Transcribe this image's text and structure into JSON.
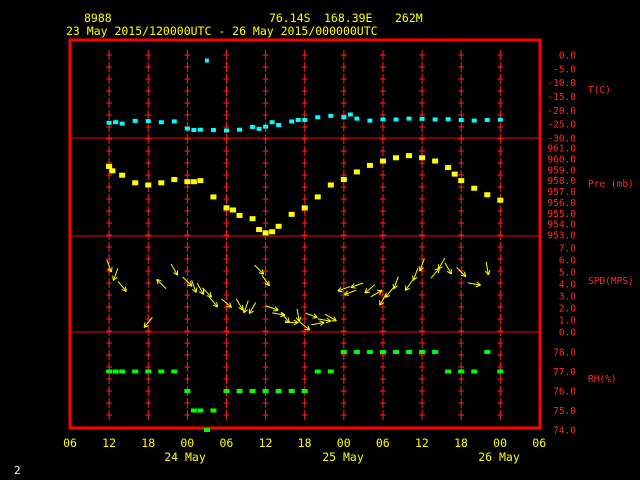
{
  "header": {
    "station": "8988",
    "lat": "76.14S",
    "lon": "168.39E",
    "elev": "262M",
    "period": "23 May 2015/120000UTC - 26 May 2015/000000UTC"
  },
  "corner_label": "2",
  "colors": {
    "frame": "#ff0000",
    "temp": "#00ffff",
    "pressure": "#ffff00",
    "wind": "#ffff00",
    "rh": "#00ff00",
    "labels": "#ffff00",
    "axis_text": "#ff2a2a"
  },
  "chart_data": [
    {
      "type": "scatter",
      "name": "T(C)",
      "ylabel": "T(C)",
      "ylim": [
        -30.0,
        0.0
      ],
      "yticks": [
        "0.0",
        "-5.0",
        "-10.0",
        "-15.0",
        "-20.0",
        "-25.0",
        "-30.0"
      ],
      "x_hours": [
        12,
        13,
        14,
        16,
        18,
        20,
        22,
        24,
        25,
        26,
        28,
        30,
        32,
        34,
        35,
        36,
        37,
        38,
        40,
        41,
        42,
        44,
        46,
        48,
        49,
        50,
        52,
        54,
        56,
        58,
        60,
        62,
        64,
        66,
        68,
        70,
        72
      ],
      "values": [
        -24.5,
        -24.3,
        -24.8,
        -23.8,
        -23.9,
        -24.3,
        -24.0,
        -26.6,
        -27.1,
        -27.0,
        -27.1,
        -27.3,
        -27.0,
        -26.0,
        -26.7,
        -25.9,
        -24.3,
        -25.3,
        -24.0,
        -23.5,
        -23.5,
        -22.5,
        -22.0,
        -22.5,
        -21.5,
        -23.0,
        -23.7,
        -23.3,
        -23.3,
        -23.0,
        -23.1,
        -23.3,
        -23.2,
        -23.5,
        -23.7,
        -23.5,
        -23.4
      ],
      "outliers": [
        {
          "x_hour": 27,
          "value": -2.0
        }
      ]
    },
    {
      "type": "scatter",
      "name": "Pre (mb)",
      "ylabel": "Pre (mb)",
      "ylim": [
        953.0,
        961.0
      ],
      "yticks": [
        "961.0",
        "960.0",
        "959.0",
        "958.0",
        "957.0",
        "956.0",
        "955.0",
        "954.0",
        "953.0"
      ],
      "x_hours": [
        12,
        12.5,
        14,
        16,
        18,
        20,
        22,
        24,
        25,
        26,
        28,
        30,
        31,
        32,
        34,
        35,
        36,
        37,
        38,
        40,
        42,
        44,
        46,
        48,
        50,
        52,
        54,
        56,
        58,
        60,
        62,
        64,
        65,
        66,
        68,
        70,
        72
      ],
      "values": [
        959.3,
        958.9,
        958.5,
        957.8,
        957.6,
        957.8,
        958.1,
        957.9,
        957.9,
        958.0,
        956.5,
        955.5,
        955.3,
        954.8,
        954.5,
        953.5,
        953.2,
        953.3,
        953.8,
        954.9,
        955.5,
        956.5,
        957.6,
        958.1,
        958.8,
        959.4,
        959.8,
        960.1,
        960.3,
        960.1,
        959.8,
        959.2,
        958.6,
        958.0,
        957.3,
        956.7,
        956.2
      ]
    },
    {
      "type": "scatter",
      "name": "SPD(MPS)",
      "ylabel": "SPD(MPS)",
      "ylim": [
        0.0,
        7.0
      ],
      "yticks": [
        "7.0",
        "6.0",
        "5.0",
        "4.0",
        "3.0",
        "2.0",
        "1.0",
        "0.0"
      ],
      "x_hours": [
        12,
        13,
        14,
        18,
        20,
        22,
        24,
        25,
        26,
        27,
        28,
        30,
        32,
        33,
        34,
        35,
        36,
        37,
        38,
        39,
        40,
        41,
        42,
        43,
        44,
        45,
        46,
        48,
        49,
        50,
        52,
        53,
        54,
        55,
        56,
        58,
        59,
        60,
        62,
        63,
        64,
        66,
        68,
        70
      ],
      "values": [
        5.5,
        4.8,
        3.8,
        0.8,
        4.0,
        5.2,
        4.2,
        3.8,
        3.6,
        3.3,
        2.5,
        2.4,
        2.3,
        2.1,
        2.0,
        5.2,
        4.3,
        2.0,
        1.5,
        1.2,
        0.8,
        1.4,
        0.5,
        1.4,
        0.7,
        1.0,
        1.2,
        3.6,
        3.3,
        3.9,
        3.6,
        3.2,
        2.7,
        3.3,
        4.1,
        3.9,
        4.8,
        5.6,
        4.9,
        5.7,
        5.3,
        5.0,
        4.0,
        5.3
      ],
      "directions_deg": [
        160,
        200,
        140,
        220,
        315,
        150,
        135,
        160,
        150,
        135,
        140,
        130,
        150,
        200,
        210,
        135,
        145,
        110,
        100,
        140,
        90,
        170,
        130,
        110,
        80,
        100,
        120,
        250,
        250,
        250,
        230,
        60,
        210,
        220,
        200,
        215,
        200,
        200,
        40,
        210,
        150,
        135,
        100,
        170
      ]
    },
    {
      "type": "scatter",
      "name": "RH(%)",
      "ylabel": "RH(%)",
      "ylim": [
        74.0,
        78.0
      ],
      "yticks": [
        "78.0",
        "77.0",
        "76.0",
        "75.0",
        "74.0"
      ],
      "x_hours": [
        12,
        13,
        14,
        16,
        18,
        20,
        22,
        24,
        25,
        26,
        28,
        30,
        32,
        34,
        36,
        38,
        40,
        42,
        44,
        46,
        48,
        50,
        52,
        54,
        56,
        58,
        60,
        62,
        64,
        66,
        68,
        70,
        72,
        27
      ],
      "values": [
        77.0,
        77.0,
        77.0,
        77.0,
        77.0,
        77.0,
        77.0,
        76.0,
        75.0,
        75.0,
        75.0,
        76.0,
        76.0,
        76.0,
        76.0,
        76.0,
        76.0,
        76.0,
        77.0,
        77.0,
        78.0,
        78.0,
        78.0,
        78.0,
        78.0,
        78.0,
        78.0,
        78.0,
        77.0,
        77.0,
        77.0,
        78.0,
        77.0,
        74.0
      ]
    }
  ],
  "x_axis": {
    "hour_labels": [
      "06",
      "12",
      "18",
      "00",
      "06",
      "12",
      "18",
      "00",
      "06",
      "12",
      "18",
      "00",
      "06"
    ],
    "date_labels": [
      "24 May",
      "25 May",
      "26 May"
    ]
  }
}
